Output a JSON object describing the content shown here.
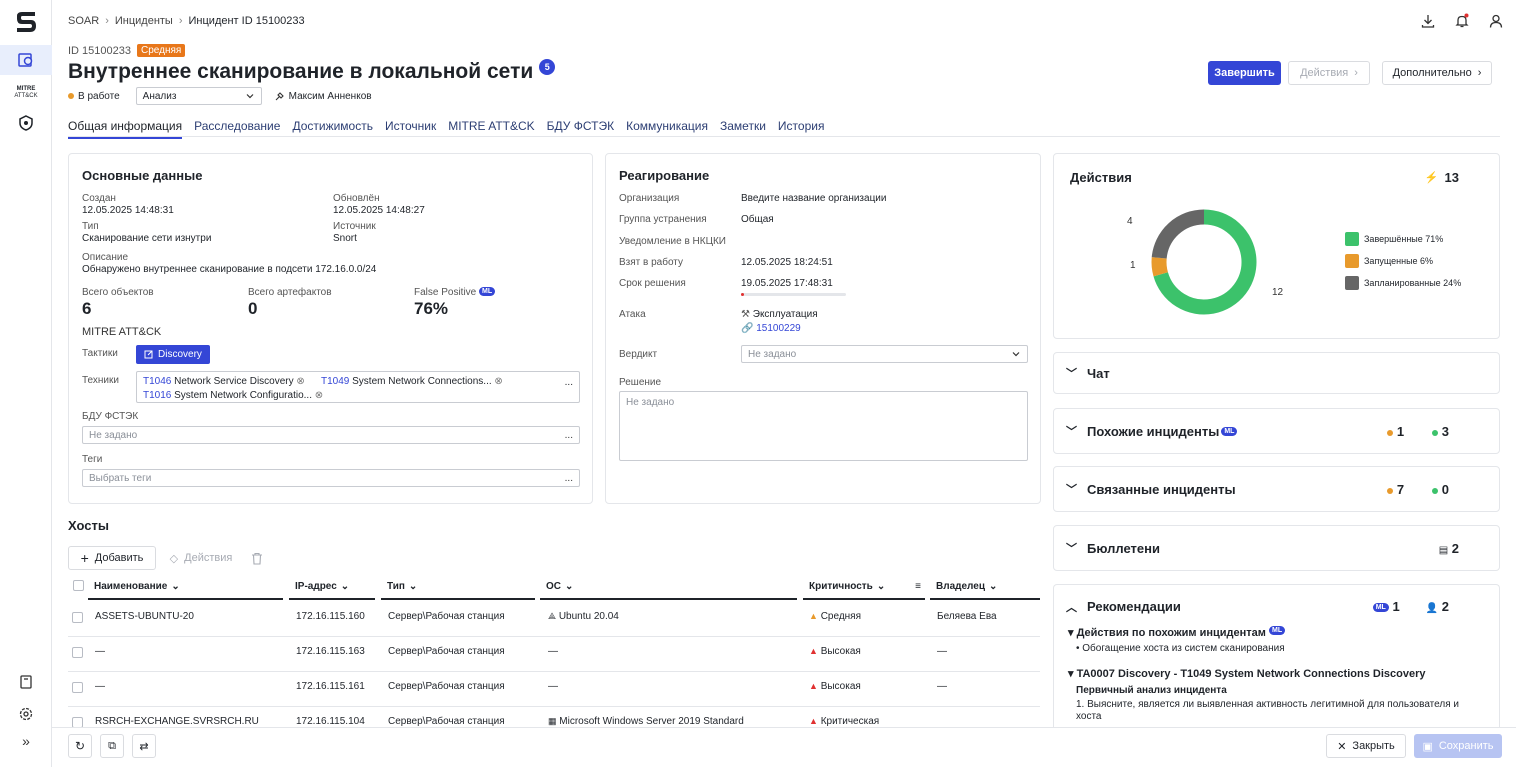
{
  "nav": {
    "mitre_label_1": "MITRE",
    "mitre_label_2": "ATT&CK"
  },
  "breadcrumb": [
    "SOAR",
    "Инциденты",
    "Инцидент ID 15100233"
  ],
  "incident": {
    "id": "ID 15100233",
    "severity": "Средняя",
    "title": "Внутреннее сканирование в локальной сети",
    "title_count": "5",
    "status": "В работе",
    "stage": "Анализ",
    "assignee": "Максим Анненков"
  },
  "buttons": {
    "finish": "Завершить",
    "actions": "Действия",
    "more": "Дополнительно",
    "add": "Добавить",
    "row_actions": "Действия",
    "close": "Закрыть",
    "save": "Сохранить"
  },
  "tabs": [
    "Общая информация",
    "Расследование",
    "Достижимость",
    "Источник",
    "MITRE ATT&CK",
    "БДУ ФСТЭК",
    "Коммуникация",
    "Заметки",
    "История"
  ],
  "main": {
    "title": "Основные данные",
    "created_label": "Создан",
    "created": "12.05.2025 14:48:31",
    "updated_label": "Обновлён",
    "updated": "12.05.2025 14:48:27",
    "type_label": "Тип",
    "type": "Сканирование сети изнутри",
    "source_label": "Источник",
    "source": "Snort",
    "desc_label": "Описание",
    "desc": "Обнаружено внутреннее сканирование в подсети 172.16.0.0/24",
    "objects_label": "Всего объектов",
    "objects": "6",
    "artifacts_label": "Всего артефактов",
    "artifacts": "0",
    "fp_label": "False Positive",
    "ml": "ML",
    "fp": "76%",
    "mitre_label": "MITRE ATT&CK",
    "tactics_label": "Тактики",
    "tactic": "Discovery",
    "techniques_label": "Техники",
    "t1_id": "T1046",
    "t1": "Network Service Discovery",
    "t2_id": "T1049",
    "t2": "System Network Connections...",
    "t3_id": "T1016",
    "t3": "System Network Configuratio...",
    "more": "...",
    "bdu_label": "БДУ ФСТЭК",
    "bdu_ph": "Не задано",
    "tags_label": "Теги",
    "tags_ph": "Выбрать теги"
  },
  "resp": {
    "title": "Реагирование",
    "org_label": "Организация",
    "org": "Введите название организации",
    "group_label": "Группа устранения",
    "group": "Общая",
    "nkcki_label": "Уведомление в НКЦКИ",
    "taken_label": "Взят в работу",
    "taken": "12.05.2025 18:24:51",
    "due_label": "Срок решения",
    "due": "19.05.2025 17:48:31",
    "attack_label": "Атака",
    "attack": "Эксплуатация",
    "attack_link": "15100229",
    "verdict_label": "Вердикт",
    "verdict_ph": "Не задано",
    "solution_label": "Решение",
    "solution_ph": "Не задано"
  },
  "actions_card": {
    "title": "Действия",
    "total": "13",
    "legend": [
      {
        "label": "Завершённые 71%",
        "color": "#3cc26b"
      },
      {
        "label": "Запущенные 6%",
        "color": "#e89a2c"
      },
      {
        "label": "Запланированные 24%",
        "color": "#666666"
      }
    ],
    "label_4": "4",
    "label_1": "1",
    "label_12": "12"
  },
  "chart_data": {
    "type": "pie",
    "categories": [
      "Завершённые",
      "Запущенные",
      "Запланированные"
    ],
    "values": [
      12,
      1,
      4
    ],
    "total": 13
  },
  "accordions": {
    "chat": "Чат",
    "similar": "Похожие инциденты",
    "similar_orange": "1",
    "similar_green": "3",
    "related": "Связанные инциденты",
    "related_orange": "7",
    "related_green": "0",
    "bulletins": "Бюллетени",
    "bulletins_count": "2",
    "recs": "Рекомендации",
    "recs_ml": "ML",
    "recs_ml_count": "1",
    "recs_user_count": "2",
    "recs_sub1": "Действия по похожим инцидентам",
    "recs_sub1_item": "• Обогащение хоста из систем сканирования",
    "recs_sub2": "TA0007 Discovery - T1049 System Network Connections Discovery",
    "recs_sub2_h": "Первичный анализ инцидента",
    "recs_sub2_text1": "1. Выясните, является ли выявленная активность легитимной для пользователя и",
    "recs_sub2_text2": "хоста"
  },
  "hosts": {
    "title": "Хосты",
    "columns": [
      "Наименование",
      "IP-адрес",
      "Тип",
      "ОС",
      "Критичность",
      "Владелец"
    ],
    "rows": [
      {
        "name": "ASSETS-UBUNTU-20",
        "ip": "172.16.115.160",
        "type": "Сервер\\Рабочая станция",
        "os": "Ubuntu 20.04",
        "crit": "Средняя",
        "owner": "Беляева Ева"
      },
      {
        "name": "—",
        "ip": "172.16.115.163",
        "type": "Сервер\\Рабочая станция",
        "os": "—",
        "crit": "Высокая",
        "owner": "—"
      },
      {
        "name": "—",
        "ip": "172.16.115.161",
        "type": "Сервер\\Рабочая станция",
        "os": "—",
        "crit": "Высокая",
        "owner": "—"
      },
      {
        "name": "RSRCH-EXCHANGE.SVRSRCH.RU",
        "ip": "172.16.115.104",
        "type": "Сервер\\Рабочая станция",
        "os": "Microsoft Windows Server 2019 Standard",
        "crit": "Критическая",
        "owner": ""
      }
    ]
  },
  "colors": {
    "accent": "#3446d6",
    "orange": "#e89a2c",
    "green": "#3cc26b",
    "red": "#e03131"
  }
}
